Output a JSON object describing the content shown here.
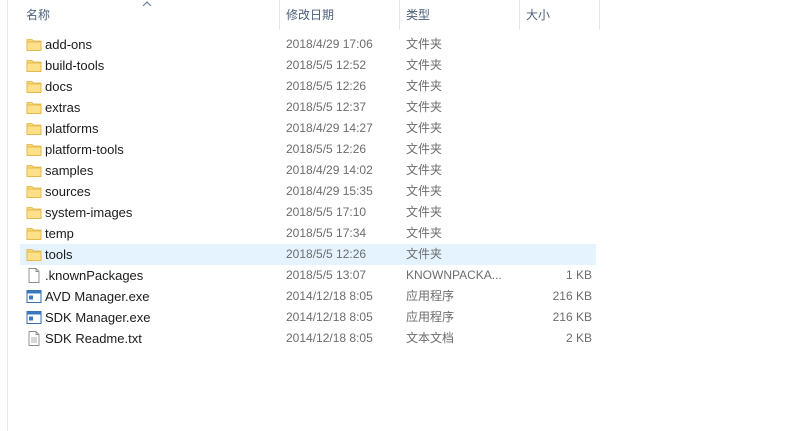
{
  "columns": {
    "name": "名称",
    "modified": "修改日期",
    "type": "类型",
    "size": "大小"
  },
  "sort": {
    "column": "name",
    "direction": "ascending",
    "icon": "chevron-up-icon"
  },
  "colors": {
    "selection": "#e5f3ff",
    "folder": "#f8d775",
    "header_text": "#4c607a"
  },
  "files": [
    {
      "icon": "folder-icon",
      "name": "add-ons",
      "modified": "2018/4/29 17:06",
      "type": "文件夹",
      "size": ""
    },
    {
      "icon": "folder-icon",
      "name": "build-tools",
      "modified": "2018/5/5 12:52",
      "type": "文件夹",
      "size": ""
    },
    {
      "icon": "folder-icon",
      "name": "docs",
      "modified": "2018/5/5 12:26",
      "type": "文件夹",
      "size": ""
    },
    {
      "icon": "folder-icon",
      "name": "extras",
      "modified": "2018/5/5 12:37",
      "type": "文件夹",
      "size": ""
    },
    {
      "icon": "folder-icon",
      "name": "platforms",
      "modified": "2018/4/29 14:27",
      "type": "文件夹",
      "size": ""
    },
    {
      "icon": "folder-icon",
      "name": "platform-tools",
      "modified": "2018/5/5 12:26",
      "type": "文件夹",
      "size": ""
    },
    {
      "icon": "folder-icon",
      "name": "samples",
      "modified": "2018/4/29 14:02",
      "type": "文件夹",
      "size": ""
    },
    {
      "icon": "folder-icon",
      "name": "sources",
      "modified": "2018/4/29 15:35",
      "type": "文件夹",
      "size": ""
    },
    {
      "icon": "folder-icon",
      "name": "system-images",
      "modified": "2018/5/5 17:10",
      "type": "文件夹",
      "size": ""
    },
    {
      "icon": "folder-icon",
      "name": "temp",
      "modified": "2018/5/5 17:34",
      "type": "文件夹",
      "size": ""
    },
    {
      "icon": "folder-icon",
      "name": "tools",
      "modified": "2018/5/5 12:26",
      "type": "文件夹",
      "size": "",
      "selected": true
    },
    {
      "icon": "file-icon",
      "name": ".knownPackages",
      "modified": "2018/5/5 13:07",
      "type": "KNOWNPACKA...",
      "size": "1 KB"
    },
    {
      "icon": "exe-icon",
      "name": "AVD Manager.exe",
      "modified": "2014/12/18 8:05",
      "type": "应用程序",
      "size": "216 KB"
    },
    {
      "icon": "exe-icon",
      "name": "SDK Manager.exe",
      "modified": "2014/12/18 8:05",
      "type": "应用程序",
      "size": "216 KB"
    },
    {
      "icon": "text-file-icon",
      "name": "SDK Readme.txt",
      "modified": "2014/12/18 8:05",
      "type": "文本文档",
      "size": "2 KB"
    }
  ]
}
